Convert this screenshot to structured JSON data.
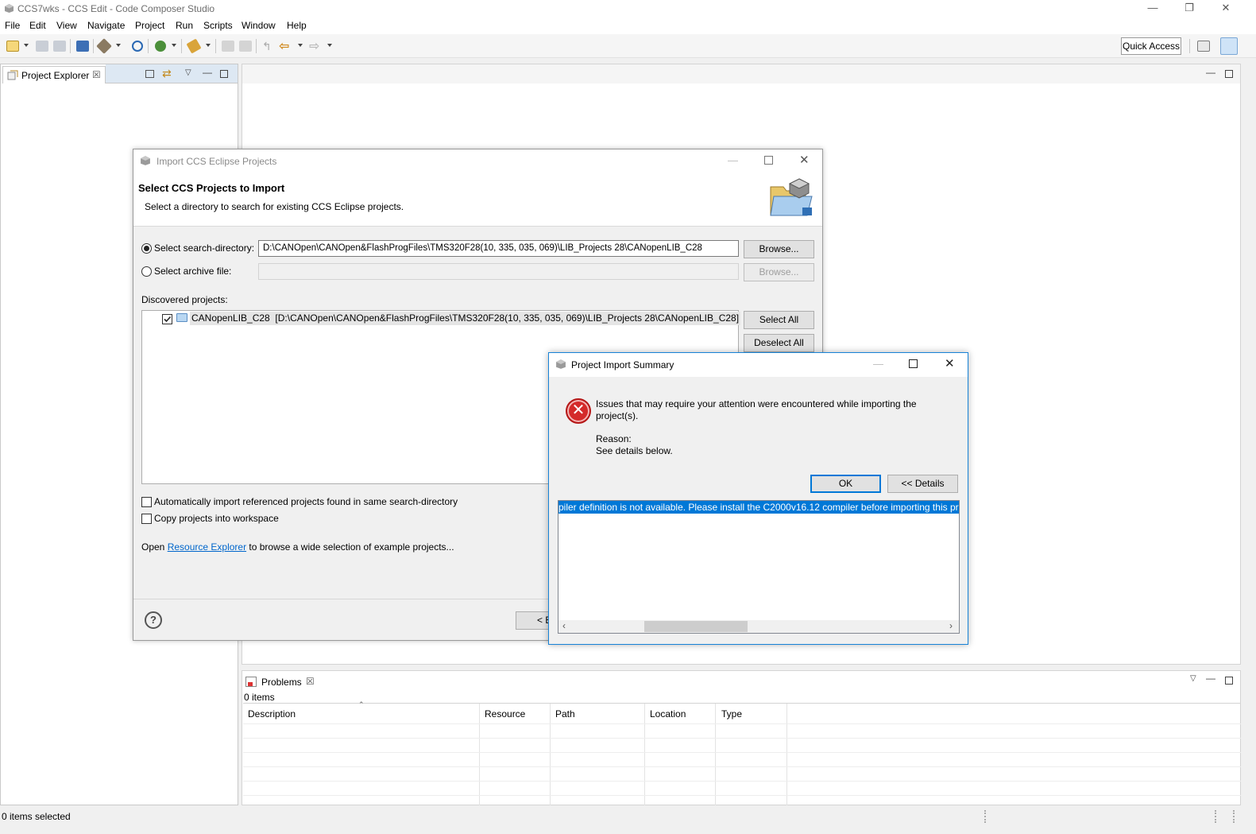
{
  "window": {
    "title": "CCS7wks - CCS Edit - Code Composer Studio"
  },
  "menubar": {
    "items": [
      "File",
      "Edit",
      "View",
      "Navigate",
      "Project",
      "Run",
      "Scripts",
      "Window",
      "Help"
    ]
  },
  "toolbar": {
    "quick_access_label": "Quick Access"
  },
  "project_explorer": {
    "tab_label": "Project Explorer"
  },
  "problems": {
    "tab_label": "Problems",
    "count_text": "0 items",
    "columns": [
      "Description",
      "Resource",
      "Path",
      "Location",
      "Type"
    ]
  },
  "status_bar": {
    "text": "0 items selected"
  },
  "import_dialog": {
    "title": "Import CCS Eclipse Projects",
    "heading": "Select CCS Projects to Import",
    "description": "Select a directory to search for existing CCS Eclipse projects.",
    "search_dir_label": "Select search-directory:",
    "search_dir_value": "D:\\CANOpen\\CANOpen&FlashProgFiles\\TMS320F28(10, 335, 035, 069)\\LIB_Projects 28\\CANopenLIB_C28",
    "archive_label": "Select archive file:",
    "archive_value": "",
    "browse_label": "Browse...",
    "browse_label_2": "Browse...",
    "discovered_label": "Discovered projects:",
    "project_name": "CANopenLIB_C28",
    "project_path": "[D:\\CANOpen\\CANOpen&FlashProgFiles\\TMS320F28(10, 335, 035, 069)\\LIB_Projects 28\\CANopenLIB_C28]",
    "select_all_label": "Select All",
    "deselect_all_label": "Deselect All",
    "auto_import_label": "Automatically import referenced projects found in same search-directory",
    "copy_label": "Copy projects into workspace",
    "open_prefix": "Open ",
    "resource_explorer_link": "Resource Explorer",
    "open_suffix": " to browse a wide selection of example projects...",
    "back_label_partial": "< B"
  },
  "summary_dialog": {
    "title": "Project Import Summary",
    "message": "Issues that may require your attention were encountered while importing the project(s).",
    "reason_label": "Reason:",
    "reason_text": "See details below.",
    "ok_label": "OK",
    "details_label": "<< Details",
    "details_text": "piler definition is not available. Please install the C2000v16.12 compiler before importing this proj"
  },
  "colors": {
    "accent": "#0078d7",
    "error": "#d42a2a",
    "selection": "#0078d7"
  }
}
